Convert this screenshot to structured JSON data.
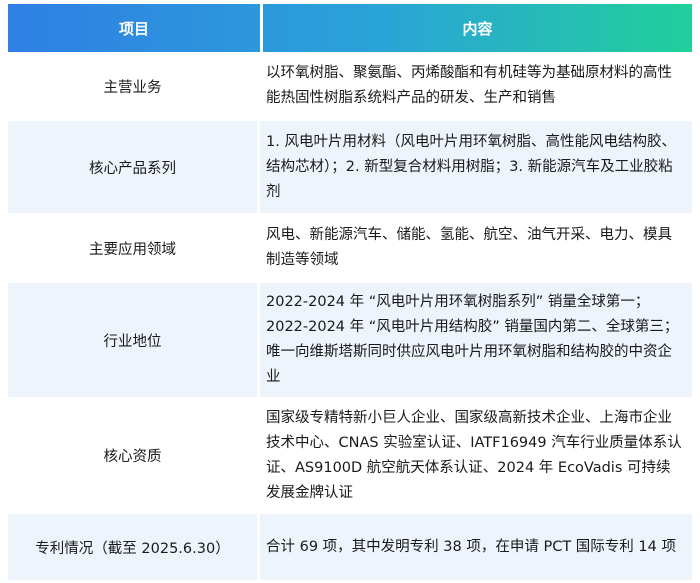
{
  "header": {
    "col1": "项目",
    "col2": "内容"
  },
  "rows": [
    {
      "label": "主营业务",
      "content": "以环氧树脂、聚氨酯、丙烯酸酯和有机硅等为基础原材料的高性能热固性树脂系统料产品的研发、生产和销售"
    },
    {
      "label": "核心产品系列",
      "content": "1. 风电叶片用材料（风电叶片用环氧树脂、高性能风电结构胶、结构芯材）；2. 新型复合材料用树脂；3. 新能源汽车及工业胶粘剂"
    },
    {
      "label": "主要应用领域",
      "content": "风电、新能源汽车、储能、氢能、航空、油气开采、电力、模具制造等领域"
    },
    {
      "label": "行业地位",
      "content": "2022-2024 年 “风电叶片用环氧树脂系列” 销量全球第一；2022-2024 年 “风电叶片用结构胶” 销量国内第二、全球第三；唯一向维斯塔斯同时供应风电叶片用环氧树脂和结构胶的中资企业"
    },
    {
      "label": "核心资质",
      "content": "国家级专精特新小巨人企业、国家级高新技术企业、上海市企业技术中心、CNAS 实验室认证、IATF16949 汽车行业质量体系认证、AS9100D 航空航天体系认证、2024 年 EcoVadis 可持续发展金牌认证"
    },
    {
      "label": "专利情况（截至 2025.6.30）",
      "content": "合计 69 项，其中发明专利 38 项，在申请 PCT 国际专利 14 项"
    }
  ],
  "colors": {
    "header_gradient_start": "#2f7fe4",
    "header_gradient_end": "#22cf9b",
    "stripe": "#eef4fb"
  }
}
